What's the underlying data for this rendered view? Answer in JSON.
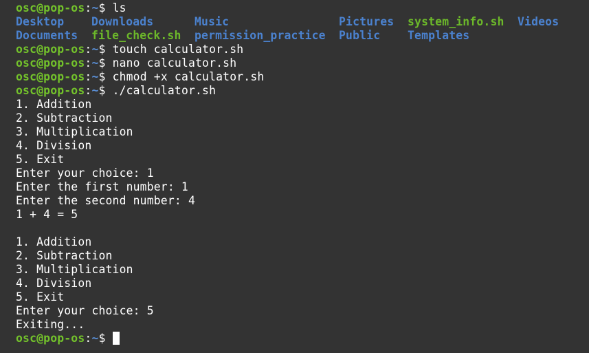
{
  "colors": {
    "background": "#333333",
    "user": "#73c22b",
    "path": "#5a8fd6",
    "directory": "#4b82cf",
    "executable": "#6cb82a",
    "text": "#ffffff"
  },
  "prompt": {
    "user_host": "osc@pop-os",
    "sep": ":",
    "path": "~",
    "sym": "$ "
  },
  "commands": {
    "c1": "ls",
    "c2": "touch calculator.sh",
    "c3": "nano calculator.sh",
    "c4": "chmod +x calculator.sh",
    "c5": "./calculator.sh"
  },
  "ls_output": {
    "row1": [
      "Desktop",
      "Downloads",
      "Music",
      "Pictures",
      "system_info.sh",
      "Videos"
    ],
    "row2": [
      "Documents",
      "file_check.sh",
      "permission_practice",
      "Public",
      "Templates"
    ]
  },
  "program_output": {
    "menu1": [
      "1. Addition",
      "2. Subtraction",
      "3. Multiplication",
      "4. Division",
      "5. Exit"
    ],
    "choice1": "Enter your choice: 1",
    "first": "Enter the first number: 1",
    "second": "Enter the second number: 4",
    "result": "1 + 4 = 5",
    "menu2": [
      "1. Addition",
      "2. Subtraction",
      "3. Multiplication",
      "4. Division",
      "5. Exit"
    ],
    "choice2": "Enter your choice: 5",
    "exiting": "Exiting..."
  }
}
